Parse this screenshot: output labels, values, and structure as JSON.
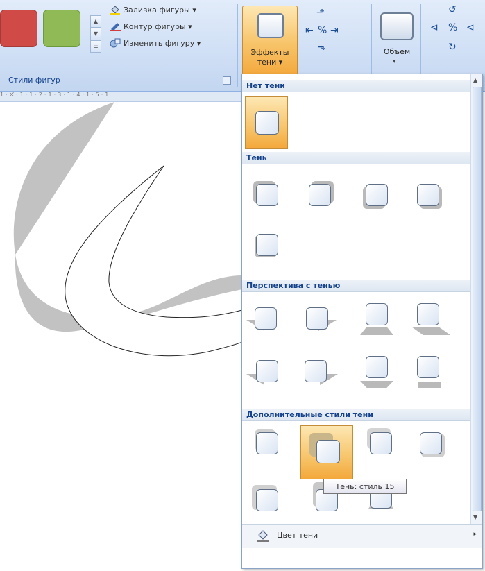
{
  "ribbon": {
    "group_label": "Стили фигур",
    "commands": {
      "fill": "Заливка фигуры ▾",
      "outline": "Контур фигуры ▾",
      "change": "Изменить фигуру ▾"
    },
    "swatch_colors": [
      "#d04b47",
      "#8fba55"
    ],
    "shadow_effects_label": "Эффекты тени ▾",
    "volume_label": "Объем"
  },
  "ruler_text": "1·⨉·1·1·2·1·3·1·4·1·5·1",
  "dropdown": {
    "sections": [
      "Нет тени",
      "Тень",
      "Перспектива с тенью",
      "Дополнительные стили тени"
    ],
    "tooltip": "Тень: стиль 15",
    "footer_label": "Цвет тени",
    "footer_arrow": "▸"
  },
  "colors": {
    "accent": "#f7c46a",
    "header_text": "#15428b",
    "ribbon_bg": "#dfe9f6"
  }
}
